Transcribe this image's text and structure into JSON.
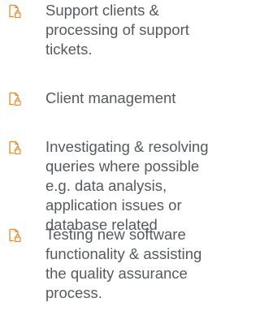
{
  "list": {
    "icon": "document-lock-icon",
    "accent_color": "#e88a2e",
    "items": [
      {
        "text": "Support clients & processing of support tickets."
      },
      {
        "text": "Client management"
      },
      {
        "text": "Investigating & resolving queries where possible e.g. data analysis, application issues or database related"
      },
      {
        "text": "Testing new software functionality & assisting the quality assurance process."
      }
    ]
  }
}
